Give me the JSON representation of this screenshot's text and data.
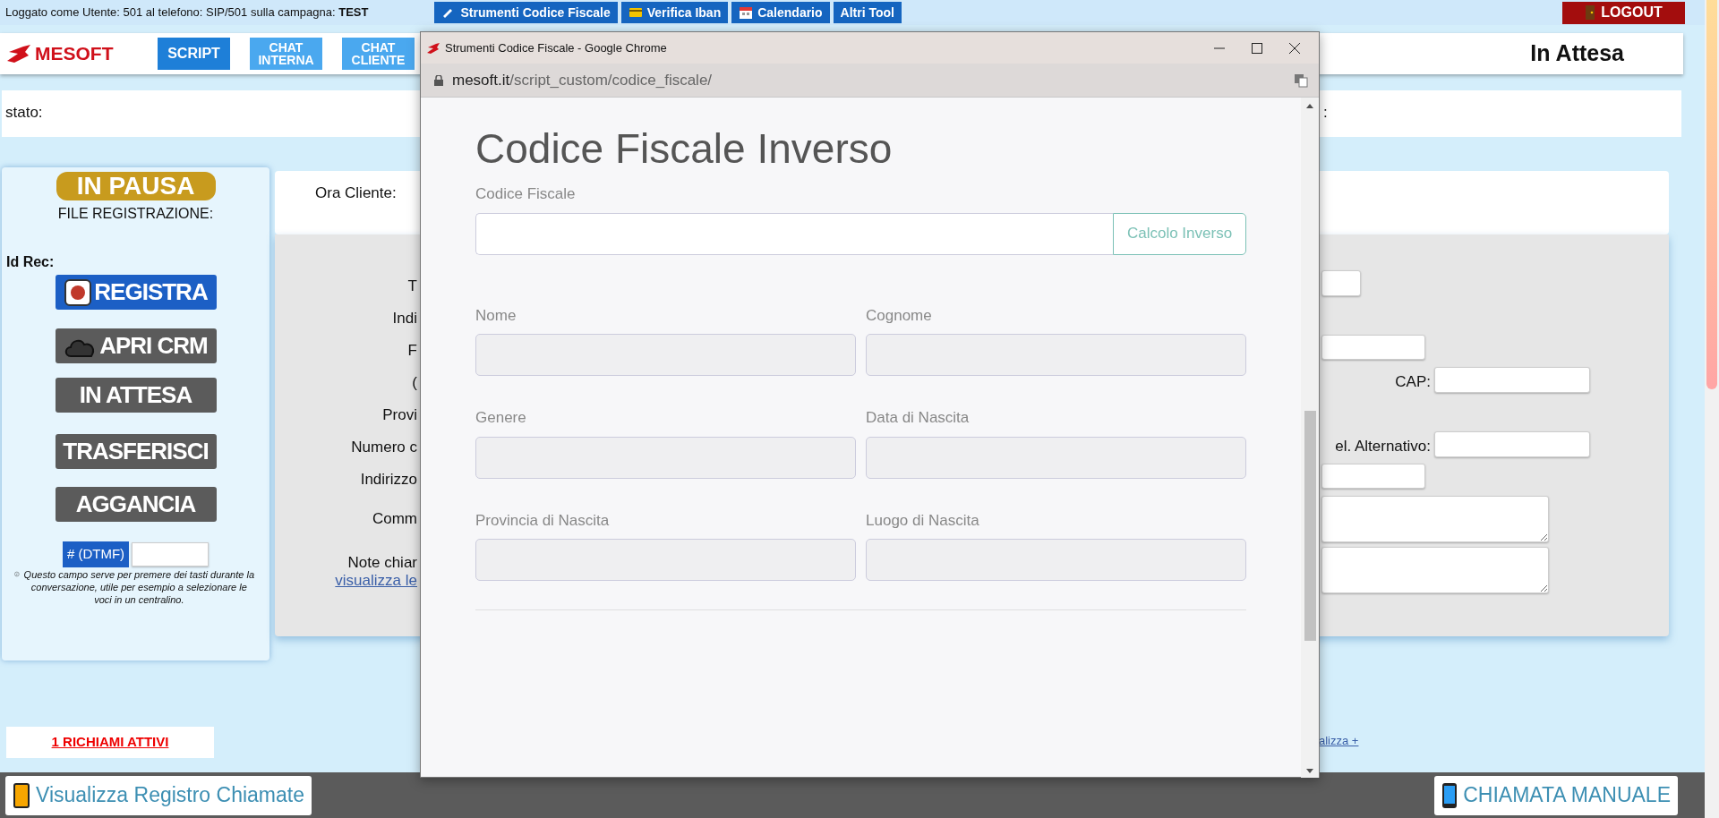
{
  "top_bar": {
    "login_text": "Loggato come Utente: 501 al telefono: SIP/501  sulla campagna: **TEST**",
    "tools": [
      {
        "label": "Strumenti Codice Fiscale"
      },
      {
        "label": "Verifica Iban"
      },
      {
        "label": "Calendario"
      },
      {
        "label": "Altri Tool"
      }
    ],
    "logout": "LOGOUT"
  },
  "header": {
    "logo": "MESOFT",
    "buttons": [
      {
        "label": "SCRIPT",
        "selected": true
      },
      {
        "label": "CHAT INTERNA",
        "selected": false
      },
      {
        "label": "CHAT CLIENTE",
        "selected": false
      }
    ],
    "status": "In Attesa"
  },
  "stato": {
    "label": "stato:",
    "trailing": ":"
  },
  "left_panel": {
    "pause_badge": "IN PAUSA",
    "file_label": "FILE REGISTRAZIONE:",
    "id_label": "Id Rec:",
    "actions": [
      {
        "label": "REGISTRA",
        "kind": "record"
      },
      {
        "label": "APRI CRM",
        "kind": "crm"
      },
      {
        "label": "IN ATTESA",
        "kind": "plain"
      },
      {
        "label": "TRASFERISCI",
        "kind": "plain"
      },
      {
        "label": "AGGANCIA",
        "kind": "plain"
      }
    ],
    "dtmf_label": "# (DTMF)",
    "dtmf_note": "Questo campo serve per premere dei tasti durante la conversazione, utile per esempio a selezionare le voci in un centralino."
  },
  "ora_cliente": "Ora Cliente:",
  "form": {
    "rows": [
      {
        "label": "T",
        "kind": "short"
      },
      {
        "label": "Indi"
      },
      {
        "label": "F",
        "kind": "medium"
      },
      {
        "label": "(",
        "kind": "labeled",
        "field_label": "CAP:"
      },
      {
        "label": "Provi"
      },
      {
        "label": "Numero c",
        "kind": "labeled",
        "field_label": "el. Alternativo:"
      },
      {
        "label": "Indirizzo",
        "kind": "medium"
      },
      {
        "label": "Comm",
        "kind": "textarea"
      },
      {
        "label": "Note chiar",
        "link": "visualizza le",
        "kind": "textarea"
      }
    ]
  },
  "richiami": "1 RICHIAMI ATTIVI",
  "more_link": "alizza +",
  "bottom_bar": {
    "log_button": "Visualizza Registro Chiamate",
    "manual_button": "CHIAMATA MANUALE"
  },
  "popup": {
    "title": "Strumenti Codice Fiscale - Google Chrome",
    "url_host": "mesoft.it",
    "url_path": "/script_custom/codice_fiscale/",
    "heading": "Codice Fiscale Inverso",
    "cf_label": "Codice Fiscale",
    "calc_button": "Calcolo Inverso",
    "fields": [
      {
        "label": "Nome",
        "disabled": true
      },
      {
        "label": "Cognome",
        "disabled": true
      },
      {
        "label": "Genere",
        "disabled": true
      },
      {
        "label": "Data di Nascita",
        "disabled": true
      },
      {
        "label": "Provincia di Nascita",
        "disabled": true
      },
      {
        "label": "Luogo di Nascita",
        "disabled": true
      }
    ]
  }
}
